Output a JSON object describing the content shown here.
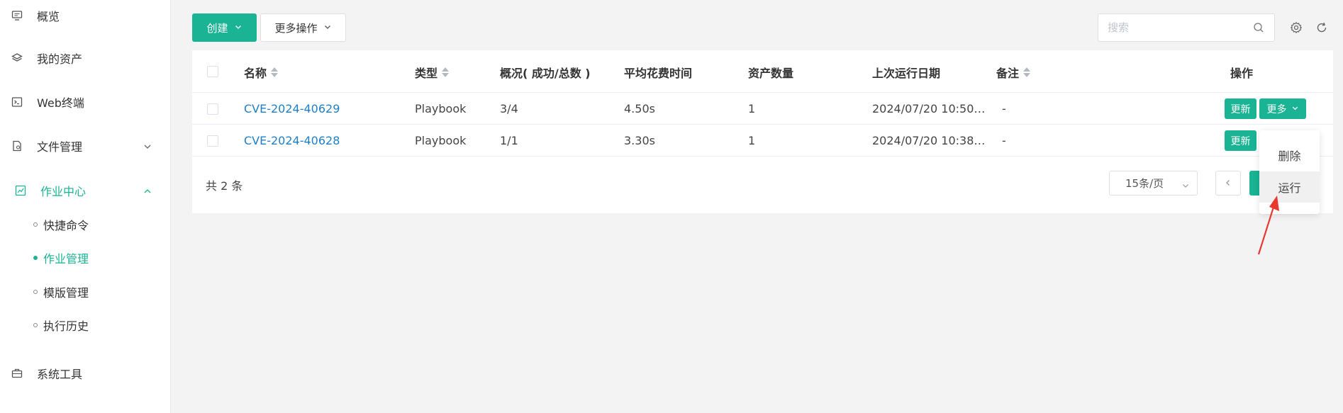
{
  "sidebar": {
    "items": [
      {
        "label": "概览",
        "icon": "monitor-icon"
      },
      {
        "label": "我的资产",
        "icon": "layers-icon"
      },
      {
        "label": "Web终端",
        "icon": "terminal-icon"
      },
      {
        "label": "文件管理",
        "icon": "file-icon"
      },
      {
        "label": "作业中心",
        "icon": "job-icon"
      },
      {
        "label": "系统工具",
        "icon": "toolbox-icon"
      }
    ],
    "sub_items": [
      {
        "label": "快捷命令"
      },
      {
        "label": "作业管理"
      },
      {
        "label": "模版管理"
      },
      {
        "label": "执行历史"
      }
    ]
  },
  "toolbar": {
    "create_label": "创建",
    "more_actions_label": "更多操作",
    "search_placeholder": "搜索"
  },
  "table": {
    "columns": [
      "名称",
      "类型",
      "概况( 成功/总数 )",
      "平均花费时间",
      "资产数量",
      "上次运行日期",
      "备注",
      "操作"
    ],
    "rows": [
      {
        "name": "CVE-2024-40629",
        "type": "Playbook",
        "summary": "3/4",
        "avg_time": "4.50s",
        "assets": "1",
        "last_run": "2024/07/20 10:50…",
        "comment": "-"
      },
      {
        "name": "CVE-2024-40628",
        "type": "Playbook",
        "summary": "1/1",
        "avg_time": "3.30s",
        "assets": "1",
        "last_run": "2024/07/20 10:38…",
        "comment": "-"
      }
    ],
    "update_label": "更新",
    "more_label": "更多"
  },
  "pagination": {
    "total": "共 2 条",
    "page_size": "15条/页"
  },
  "dropdown": {
    "items": [
      "删除",
      "运行"
    ]
  },
  "colors": {
    "accent": "#1ab394",
    "link": "#1f7fc4",
    "arrow": "#e8382f"
  }
}
